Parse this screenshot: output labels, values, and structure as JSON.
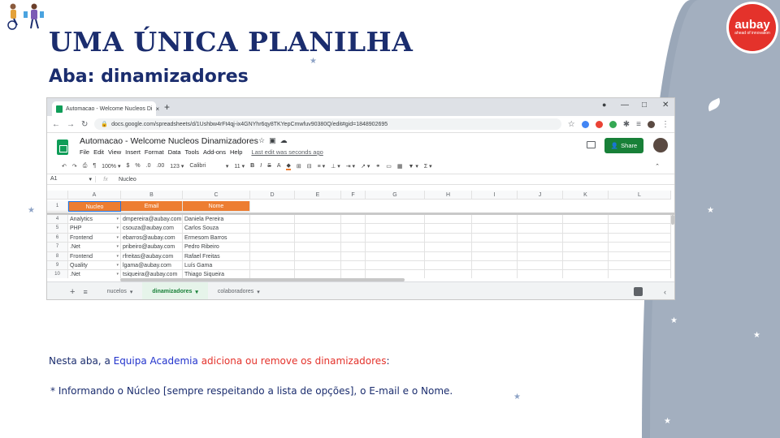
{
  "slide": {
    "title": "UMA ÚNICA PLANILHA",
    "subtitle": "Aba: dinamizadores",
    "logo": {
      "word": "aubay",
      "tagline": "ahead of innovation"
    },
    "description": {
      "prefix": "Nesta aba, a ",
      "highlight_blue": "Equipa Academia",
      "highlight_red": "adiciona ou remove os dinamizadores",
      "suffix": ":"
    },
    "note": "* Informando o Núcleo [sempre respeitando a lista de opções], o E-mail e o Nome.",
    "colors": {
      "navy": "#1b2d6e",
      "blue": "#2233cc",
      "red": "#e4322b",
      "panel": "#9aa7b8",
      "sheet_header": "#ed7d31",
      "sheets_green": "#188038"
    }
  },
  "browser": {
    "tab_title": "Automacao - Welcome Nucleos Di",
    "tab_close": "×",
    "new_tab": "+",
    "window_controls": [
      "—",
      "□",
      "✕"
    ],
    "url": "docs.google.com/spreadsheets/d/1Ushbw4rFt4qj-ix4GNYhr6qy8TKYepCmwfuv90380Q/edit#gid=1848902695"
  },
  "sheet": {
    "doc_title": "Automacao - Welcome Nucleos Dinamizadores",
    "menu": [
      "File",
      "Edit",
      "View",
      "Insert",
      "Format",
      "Data",
      "Tools",
      "Add-ons",
      "Help"
    ],
    "last_edit": "Last edit was seconds ago",
    "share_label": "Share",
    "toolbar": {
      "zoom": "100%",
      "currency": "$",
      "percent": "%",
      "dec_less": ".0",
      "dec_more": ".00",
      "format": "123",
      "font": "Calibri",
      "size": "11",
      "bold": "B",
      "italic": "I",
      "strike": "S",
      "text_color": "A",
      "sum": "Σ"
    },
    "name_box": "A1",
    "fx": "fx",
    "formula_value": "Nucleo",
    "columns": [
      "A",
      "B",
      "C",
      "D",
      "E",
      "F",
      "G",
      "H",
      "I",
      "J",
      "K",
      "L"
    ],
    "header_row": {
      "num": "1",
      "cells": [
        "Nucleo",
        "Email",
        "Nome"
      ]
    },
    "rows": [
      {
        "num": "4",
        "nucleo": "Analytics",
        "email": "dmpereira@aubay.com",
        "nome": "Daniela Pereira"
      },
      {
        "num": "5",
        "nucleo": "PHP",
        "email": "csouza@aubay.com",
        "nome": "Carlos Souza"
      },
      {
        "num": "6",
        "nucleo": "Frontend",
        "email": "ebarros@aubay.com",
        "nome": "Ermesom Barros"
      },
      {
        "num": "7",
        "nucleo": ".Net",
        "email": "pribeiro@aubay.com",
        "nome": "Pedro Ribeiro"
      },
      {
        "num": "8",
        "nucleo": "Frontend",
        "email": "rfreitas@aubay.com",
        "nome": "Rafael Freitas"
      },
      {
        "num": "9",
        "nucleo": "Quality",
        "email": "lgama@aubay.com",
        "nome": "Luís Gama"
      },
      {
        "num": "10",
        "nucleo": ".Net",
        "email": "tsiqueira@aubay.com",
        "nome": "Thiago Siqueira"
      }
    ],
    "sheet_tabs": [
      {
        "label": "nucelos",
        "active": false
      },
      {
        "label": "dinamizadores",
        "active": true
      },
      {
        "label": "colaboradores",
        "active": false
      }
    ]
  }
}
